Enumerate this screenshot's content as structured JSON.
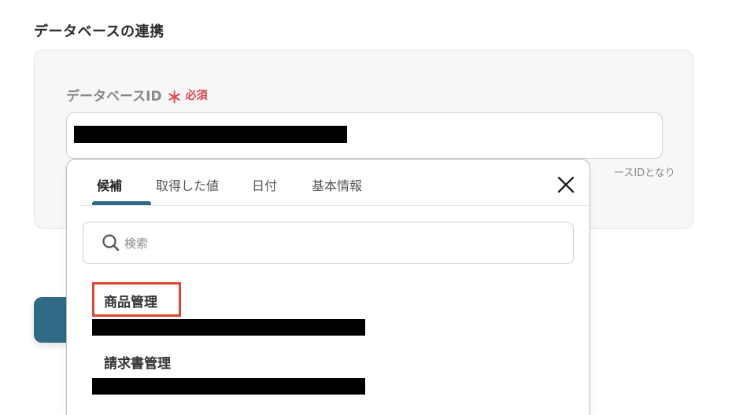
{
  "section": {
    "title": "データベースの連携"
  },
  "field": {
    "label": "データベースID",
    "required_mark": "＊",
    "required_text": "必須",
    "hint_visible_fragment": "ースIDとなり"
  },
  "popup": {
    "tabs": [
      {
        "label": "候補",
        "active": true
      },
      {
        "label": "取得した値",
        "active": false
      },
      {
        "label": "日付",
        "active": false
      },
      {
        "label": "基本情報",
        "active": false
      }
    ],
    "search": {
      "placeholder": "検索"
    },
    "options": [
      {
        "label": "商品管理",
        "highlighted": true
      },
      {
        "label": "請求書管理",
        "highlighted": false
      }
    ]
  },
  "colors": {
    "accent": "#2f6b86",
    "required": "#e0474c",
    "highlight": "#e0472f"
  },
  "icons": {
    "close": "close-icon",
    "search": "search-icon"
  }
}
